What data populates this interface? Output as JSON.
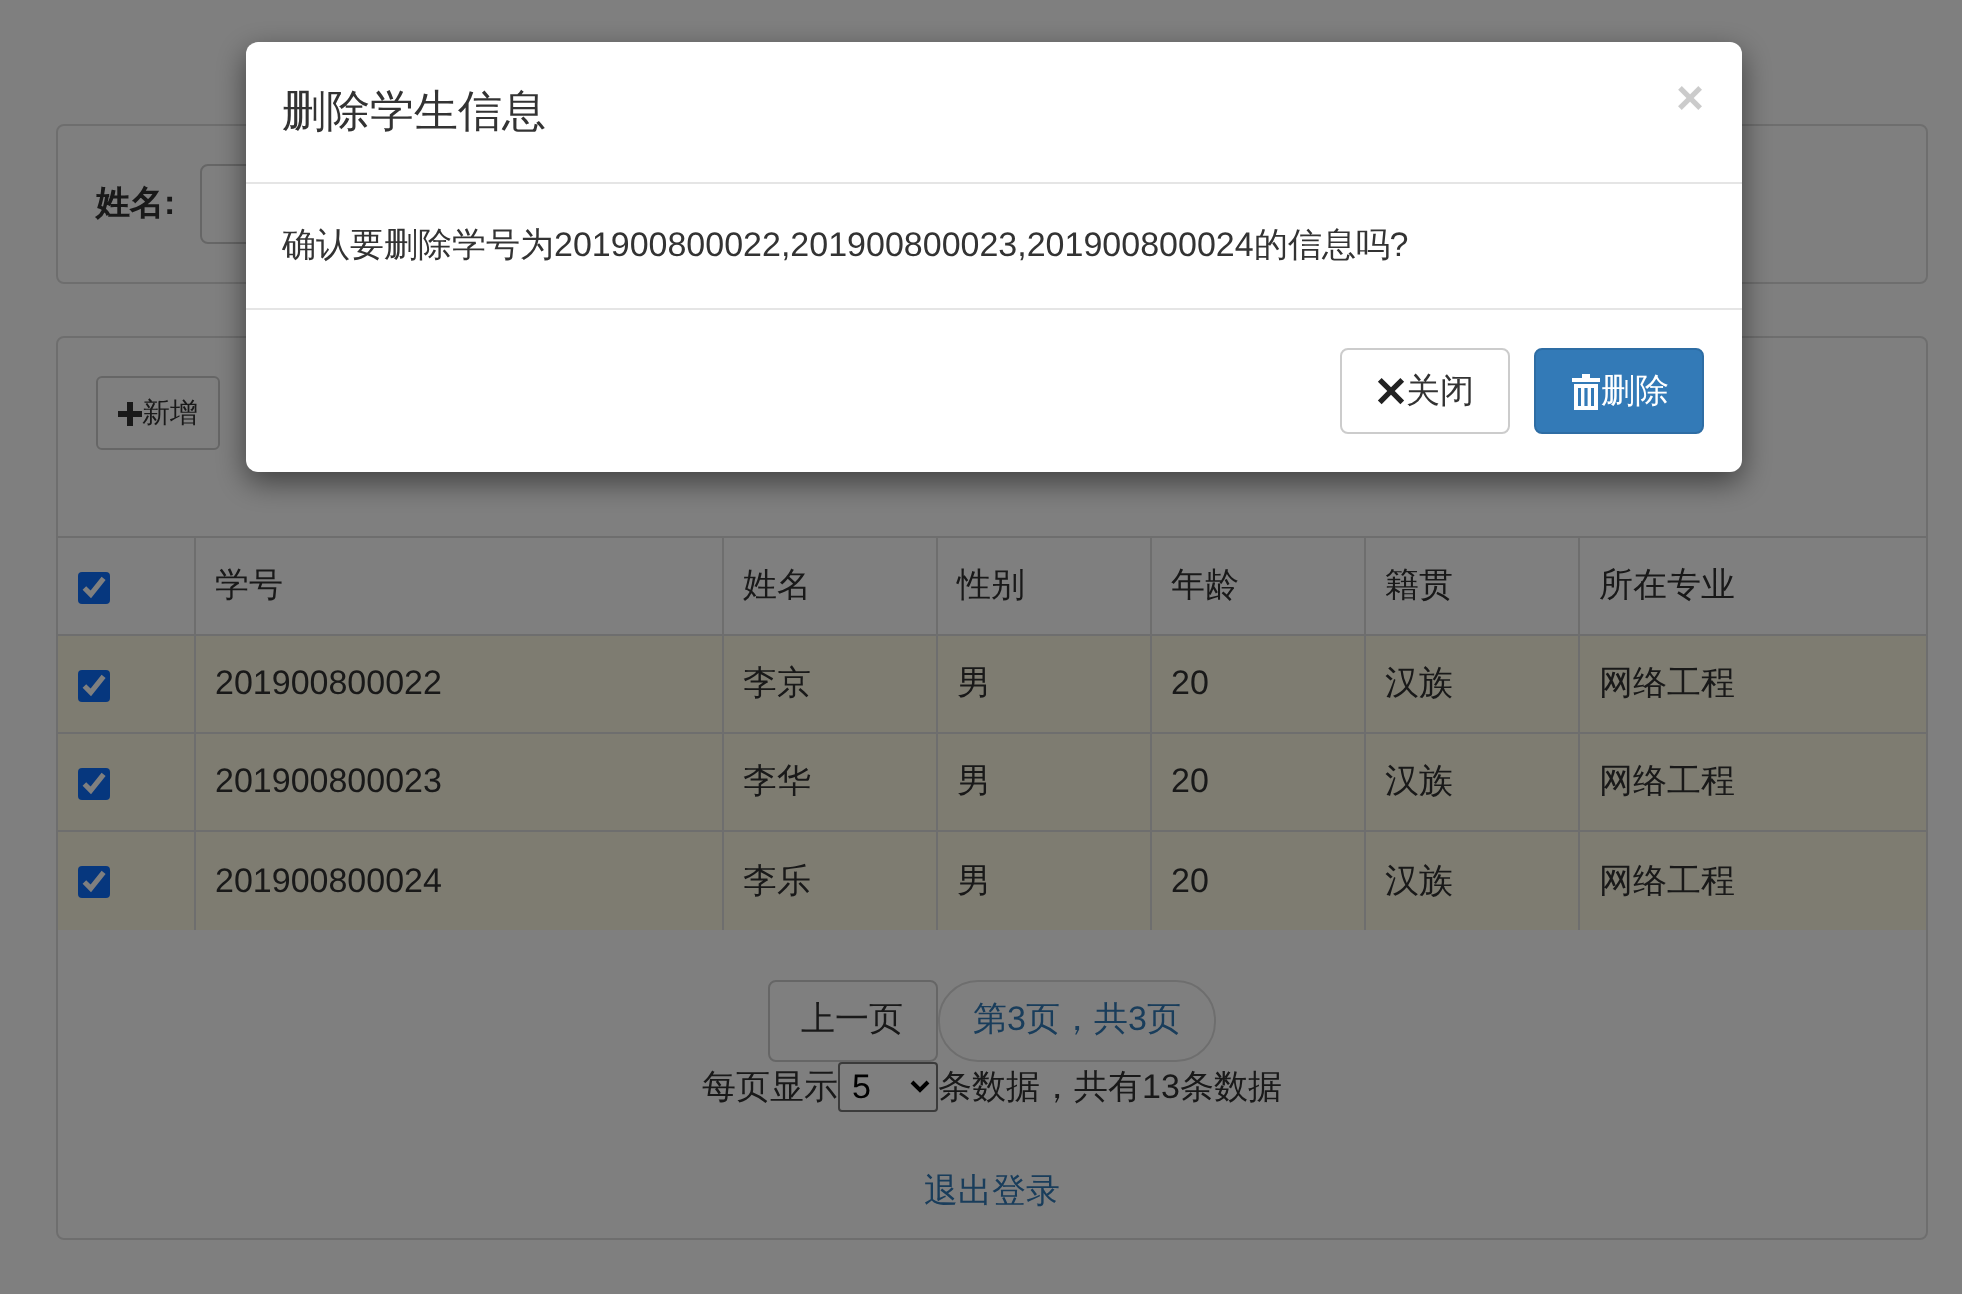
{
  "search": {
    "label": "姓名:"
  },
  "toolbar": {
    "add_button": "新增"
  },
  "table": {
    "header_checked": true,
    "columns": [
      "学号",
      "姓名",
      "性别",
      "年龄",
      "籍贯",
      "所在专业"
    ],
    "rows": [
      {
        "checked": true,
        "selected": true,
        "cells": [
          "201900800022",
          "李京",
          "男",
          "20",
          "汉族",
          "网络工程"
        ]
      },
      {
        "checked": true,
        "selected": true,
        "cells": [
          "201900800023",
          "李华",
          "男",
          "20",
          "汉族",
          "网络工程"
        ]
      },
      {
        "checked": true,
        "selected": true,
        "cells": [
          "201900800024",
          "李乐",
          "男",
          "20",
          "汉族",
          "网络工程"
        ]
      }
    ]
  },
  "pagination": {
    "prev": "上一页",
    "current": "第3页，共3页",
    "per_page_prefix": "每页显示",
    "per_page_value": "5",
    "per_page_suffix": "条数据，共有13条数据"
  },
  "logout": "退出登录",
  "modal": {
    "title": "删除学生信息",
    "close": "×",
    "message": "确认要删除学号为201900800022,201900800023,201900800024的信息吗?",
    "buttons": [
      {
        "kind": "close",
        "label": "关闭"
      },
      {
        "kind": "delete",
        "label": "删除"
      }
    ]
  }
}
